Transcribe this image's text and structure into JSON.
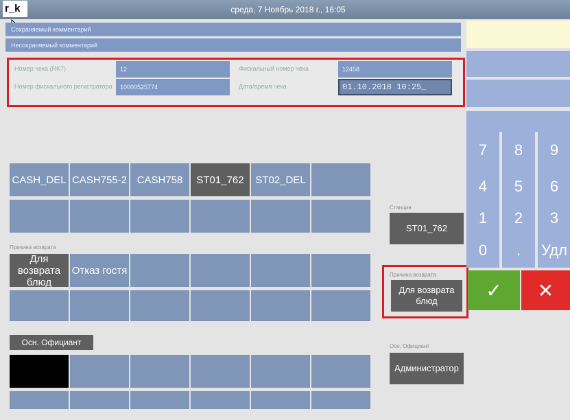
{
  "titlebar": {
    "app_name": "r_k",
    "datetime": "среда, 7 Ноябрь 2018 г., 16:05"
  },
  "comments": {
    "saved": "Сохраняемый комментарий",
    "unsaved": "Несохраняемый комментарий"
  },
  "receipt": {
    "number_label": "Номер чека (RK7)",
    "number_value": "12",
    "fiscal_number_label": "Фискальный номер чека",
    "fiscal_number_value": "12458",
    "register_label": "Номер фискального регистратора",
    "register_value": "10000525774",
    "datetime_label": "Дата/время чека",
    "datetime_value": "01.10.2018 10:25_"
  },
  "stations": [
    "CASH_DEL",
    "CASH755-2",
    "CASH758",
    "ST01_762",
    "ST02_DEL",
    ""
  ],
  "return_reason_section": "Причина возврата",
  "reasons": [
    "Для возврата блюд",
    "Отказ гостя"
  ],
  "waiter_button": "Осн. Официант",
  "side": {
    "station_label": "Станция",
    "station_value": "ST01_762",
    "reason_label": "Причина возврата",
    "reason_value": "Для возврата блюд",
    "waiter_label": "Осн. Официант",
    "waiter_value": "Администратор"
  },
  "numpad": {
    "keys": [
      "7",
      "8",
      "9",
      "4",
      "5",
      "6",
      "1",
      "2",
      "3",
      "0",
      ".",
      "Удл"
    ],
    "ok_symbol": "✓",
    "cancel_symbol": "✕",
    "ok_color": "#5ea832",
    "cancel_color": "#e12a2a"
  }
}
